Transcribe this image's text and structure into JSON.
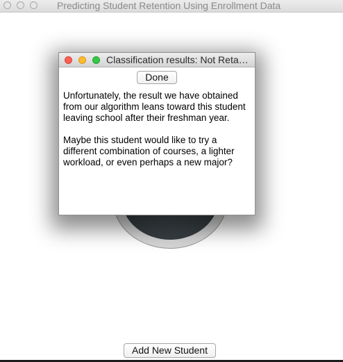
{
  "main_window": {
    "title": "Predicting Student Retention Using Enrollment Data",
    "add_button_label": "Add New Student"
  },
  "dialog": {
    "title": "Classification results: Not Reta…",
    "done_label": "Done",
    "paragraphs": [
      "Unfortunately, the result we have obtained from our algorithm leans toward this student leaving school after their freshman year.",
      "Maybe this student would like to try a different combination of courses, a lighter workload, or even perhaps a new major?"
    ]
  },
  "colors": {
    "close": "#fc5f56",
    "minimize": "#fdbb2e",
    "maximize": "#35c748",
    "wheel_dark": "#3a4246"
  }
}
